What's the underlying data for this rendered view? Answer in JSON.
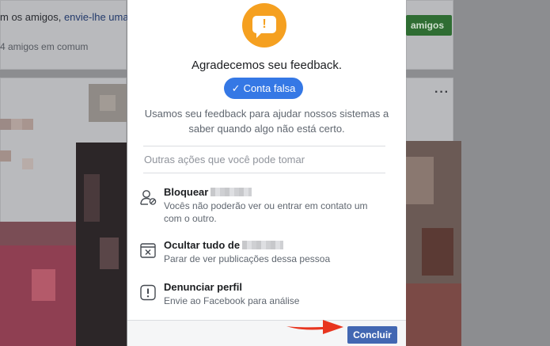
{
  "background": {
    "friends_line": "m os amigos,",
    "friends_link": "envie-lhe uma",
    "mutual": "4 amigos em comum",
    "green_button": "amigos",
    "more_menu": "···"
  },
  "modal": {
    "badge_icon": "exclamation-speech-icon",
    "badge_glyph": "!",
    "title": "Agradecemos seu feedback.",
    "selected_reason": "Conta falsa",
    "description": "Usamos seu feedback para ajudar nossos sistemas a saber quando algo não está certo.",
    "other_actions_header": "Outras ações que você pode tomar",
    "options": [
      {
        "icon": "person-block-icon",
        "title": "Bloquear",
        "desc": "Vocês não poderão ver ou entrar em contato um com o outro."
      },
      {
        "icon": "hide-box-icon",
        "title": "Ocultar tudo de",
        "desc": "Parar de ver publicações dessa pessoa"
      },
      {
        "icon": "alert-report-icon",
        "title": "Denunciar perfil",
        "desc": "Envie ao Facebook para análise"
      }
    ],
    "done_button": "Concluir"
  },
  "colors": {
    "accent_blue": "#3578e5",
    "button_blue": "#4267b2",
    "badge_orange": "#f5a020",
    "annotation_arrow": "#e8351f"
  }
}
